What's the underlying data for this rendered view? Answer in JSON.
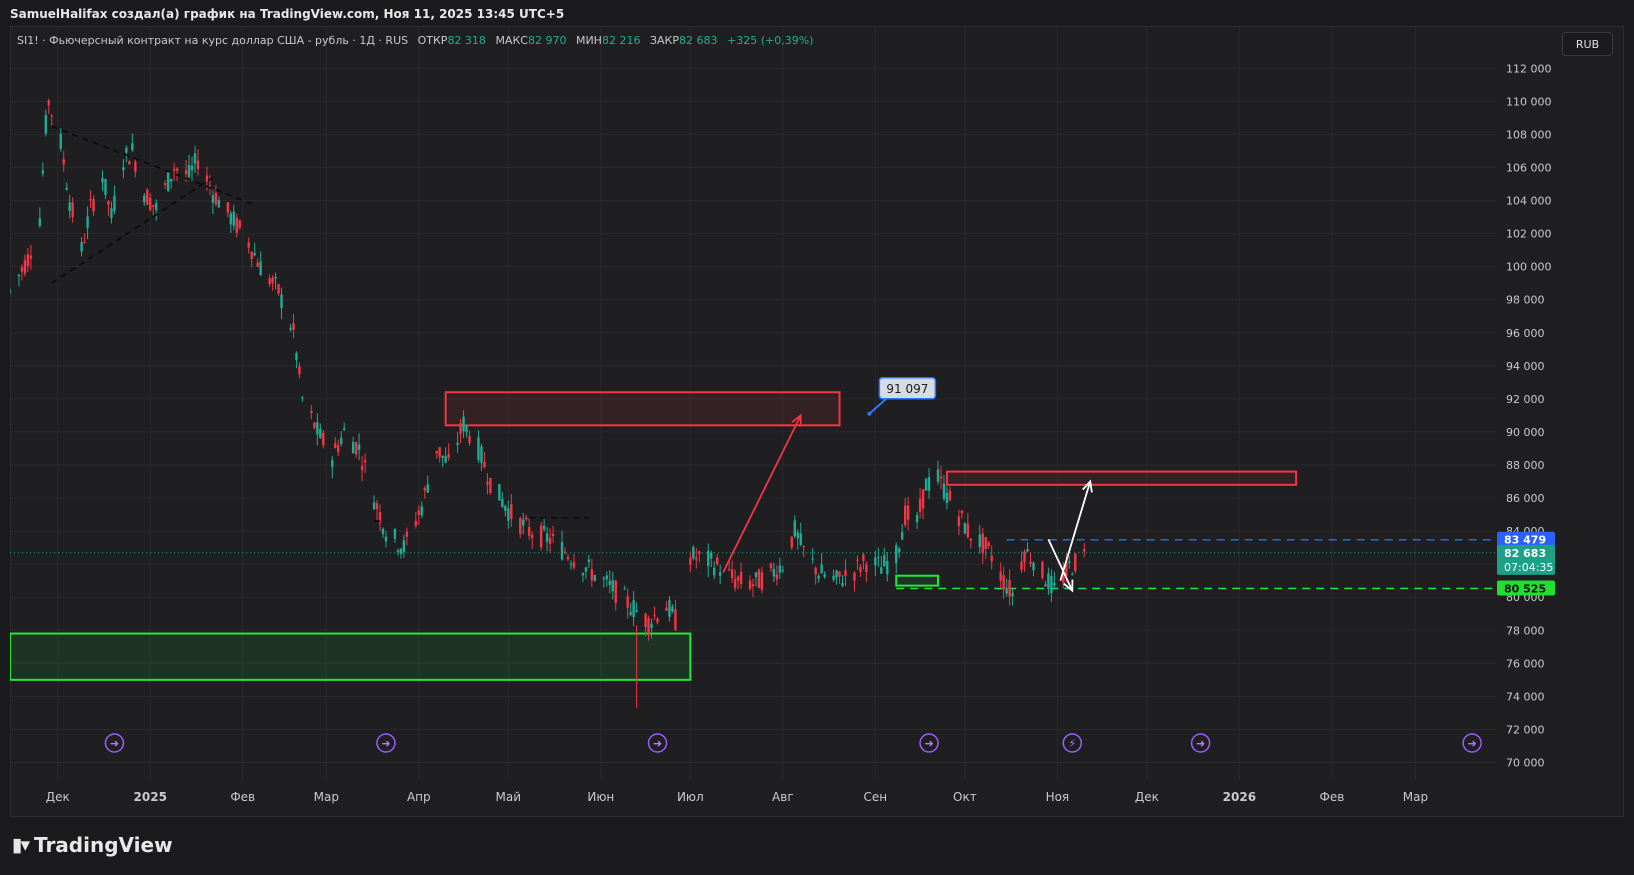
{
  "header": {
    "caption": "SamuelHalifax создал(а) график на TradingView.com, Ноя 11, 2025 13:45 UTC+5"
  },
  "legend": {
    "title": "SI1! · Фьючерсный контракт на курс доллар США - рубль · 1Д · RUS",
    "open_label": "ОТКР",
    "open": "82 318",
    "high_label": "МАКС",
    "high": "82 970",
    "low_label": "МИН",
    "low": "82 216",
    "close_label": "ЗАКР",
    "close": "82 683",
    "change": "+325 (+0,39%)"
  },
  "currency_button": "RUB",
  "brand": "TradingView",
  "colors": {
    "up": "#22ab94",
    "down": "#f23645",
    "background": "#1f1f21",
    "grid": "#2a2a2d",
    "zone_red": "#f23645",
    "zone_green": "#22e83a",
    "line_blue": "#2962ff",
    "line_green": "#22e83a",
    "arrow_white": "#ffffff"
  },
  "chart_data": {
    "type": "candlestick",
    "symbol": "SI1!",
    "interval": "1Д",
    "x_tick_labels": [
      "Дек",
      "2025",
      "Фев",
      "Мар",
      "Апр",
      "Май",
      "Июн",
      "Июл",
      "Авг",
      "Сен",
      "Окт",
      "Ноя",
      "Дек",
      "2026",
      "Фев",
      "Мар"
    ],
    "x_range": [
      "2024-11-15",
      "2026-03-28"
    ],
    "y_ticks": [
      70000,
      72000,
      74000,
      76000,
      78000,
      80000,
      82000,
      84000,
      86000,
      88000,
      90000,
      92000,
      94000,
      96000,
      98000,
      100000,
      102000,
      104000,
      106000,
      108000,
      110000,
      112000
    ],
    "y_tick_labels": [
      "70 000",
      "72 000",
      "74 000",
      "76 000",
      "78 000",
      "80 000",
      "82 000",
      "84 000",
      "86 000",
      "88 000",
      "90 000",
      "92 000",
      "94 000",
      "96 000",
      "98 000",
      "100 000",
      "102 000",
      "104 000",
      "106 000",
      "108 000",
      "110 000",
      "112 000"
    ],
    "ylim": [
      69000,
      114500
    ],
    "price_path": [
      [
        "2024-11-15",
        98500
      ],
      [
        "2024-11-21",
        100500
      ],
      [
        "2024-11-25",
        103000
      ],
      [
        "2024-11-27",
        108500
      ],
      [
        "2024-11-28",
        110000
      ],
      [
        "2024-12-02",
        107500
      ],
      [
        "2024-12-05",
        104000
      ],
      [
        "2024-12-09",
        101000
      ],
      [
        "2024-12-12",
        103500
      ],
      [
        "2024-12-16",
        105500
      ],
      [
        "2024-12-19",
        103000
      ],
      [
        "2024-12-23",
        106500
      ],
      [
        "2024-12-26",
        107000
      ],
      [
        "2024-12-30",
        104500
      ],
      [
        "2025-01-03",
        103500
      ],
      [
        "2025-01-09",
        106000
      ],
      [
        "2025-01-14",
        105500
      ],
      [
        "2025-01-17",
        106500
      ],
      [
        "2025-01-22",
        104500
      ],
      [
        "2025-01-28",
        103000
      ],
      [
        "2025-02-03",
        101500
      ],
      [
        "2025-02-07",
        100000
      ],
      [
        "2025-02-13",
        98500
      ],
      [
        "2025-02-18",
        96000
      ],
      [
        "2025-02-21",
        92000
      ],
      [
        "2025-02-26",
        90000
      ],
      [
        "2025-03-03",
        88500
      ],
      [
        "2025-03-07",
        90000
      ],
      [
        "2025-03-12",
        89000
      ],
      [
        "2025-03-17",
        86000
      ],
      [
        "2025-03-21",
        84000
      ],
      [
        "2025-03-27",
        83000
      ],
      [
        "2025-04-02",
        85500
      ],
      [
        "2025-04-07",
        89000
      ],
      [
        "2025-04-11",
        88000
      ],
      [
        "2025-04-16",
        90500
      ],
      [
        "2025-04-21",
        89000
      ],
      [
        "2025-04-25",
        87000
      ],
      [
        "2025-05-02",
        85000
      ],
      [
        "2025-05-08",
        84000
      ],
      [
        "2025-05-15",
        83500
      ],
      [
        "2025-05-22",
        82500
      ],
      [
        "2025-05-29",
        81500
      ],
      [
        "2025-06-05",
        80500
      ],
      [
        "2025-06-11",
        79500
      ],
      [
        "2025-06-17",
        78500
      ],
      [
        "2025-06-23",
        79500
      ],
      [
        "2025-06-27",
        78300
      ]
    ],
    "price_path_2": [
      [
        "2025-07-01",
        82500
      ],
      [
        "2025-07-07",
        82200
      ],
      [
        "2025-07-11",
        81800
      ],
      [
        "2025-07-16",
        81000
      ],
      [
        "2025-07-22",
        80800
      ],
      [
        "2025-07-28",
        81400
      ],
      [
        "2025-08-01",
        82000
      ],
      [
        "2025-08-05",
        84000
      ],
      [
        "2025-08-08",
        82800
      ],
      [
        "2025-08-13",
        81500
      ],
      [
        "2025-08-19",
        81000
      ],
      [
        "2025-08-25",
        81600
      ],
      [
        "2025-08-29",
        82200
      ],
      [
        "2025-09-03",
        81800
      ],
      [
        "2025-09-08",
        82500
      ],
      [
        "2025-09-11",
        85000
      ],
      [
        "2025-09-15",
        84500
      ],
      [
        "2025-09-18",
        86800
      ],
      [
        "2025-09-22",
        87200
      ],
      [
        "2025-09-25",
        86200
      ],
      [
        "2025-09-29",
        85000
      ],
      [
        "2025-10-02",
        84000
      ],
      [
        "2025-10-07",
        83200
      ],
      [
        "2025-10-10",
        82500
      ],
      [
        "2025-10-14",
        81000
      ],
      [
        "2025-10-17",
        80200
      ],
      [
        "2025-10-21",
        82800
      ],
      [
        "2025-10-24",
        82300
      ],
      [
        "2025-10-28",
        81200
      ],
      [
        "2025-10-31",
        80400
      ],
      [
        "2025-11-05",
        81800
      ],
      [
        "2025-11-11",
        82683
      ]
    ],
    "red_wick_spike": {
      "date": "2025-06-13",
      "high": 78300,
      "low": 73300
    },
    "zones": [
      {
        "color": "red",
        "from": "2025-04-10",
        "to": "2025-08-20",
        "low": 90400,
        "high": 92400
      },
      {
        "color": "red",
        "from": "2025-09-25",
        "to": "2026-01-20",
        "low": 86800,
        "high": 87600
      },
      {
        "color": "green",
        "from": "2024-11-15",
        "to": "2025-07-01",
        "low": 75000,
        "high": 77800
      },
      {
        "color": "green",
        "from": "2025-09-08",
        "to": "2025-09-22",
        "low": 80700,
        "high": 81300
      }
    ],
    "horizontal_lines": [
      {
        "price": 83479,
        "label": "83 479",
        "color": "blue",
        "style": "dashed",
        "from": "2025-10-15"
      },
      {
        "price": 80525,
        "label": "80 525",
        "color": "green",
        "style": "dashed",
        "from": "2025-09-08"
      }
    ],
    "current_price": {
      "price": 82683,
      "label": "82 683",
      "countdown": "07:04:35"
    },
    "price_note": {
      "label": "91 097",
      "date": "2025-08-30",
      "price": 91097
    },
    "arrows": [
      {
        "color": "red",
        "from": [
          "2025-07-12",
          81500
        ],
        "to": [
          "2025-08-07",
          91000
        ]
      },
      {
        "color": "white",
        "from": [
          "2025-11-02",
          81000
        ],
        "to": [
          "2025-11-12",
          87000
        ]
      },
      {
        "color": "white",
        "from": [
          "2025-10-29",
          83500
        ],
        "to": [
          "2025-11-06",
          80400
        ]
      }
    ],
    "trendlines": [
      {
        "from": [
          "2024-11-29",
          108500
        ],
        "to": [
          "2025-02-04",
          103800
        ]
      },
      {
        "from": [
          "2024-11-29",
          99000
        ],
        "to": [
          "2025-01-22",
          105400
        ]
      },
      {
        "from": [
          "2025-05-08",
          84800
        ],
        "to": [
          "2025-05-28",
          84800
        ]
      },
      {
        "from": [
          "2025-03-17",
          84600
        ],
        "to": [
          "2025-03-21",
          84600
        ]
      }
    ],
    "event_markers": [
      {
        "date": "2024-12-20",
        "icon": "dividend-arrow-icon"
      },
      {
        "date": "2025-03-21",
        "icon": "dividend-arrow-icon"
      },
      {
        "date": "2025-06-20",
        "icon": "dividend-arrow-icon"
      },
      {
        "date": "2025-09-19",
        "icon": "dividend-arrow-icon"
      },
      {
        "date": "2025-11-06",
        "icon": "lightning-icon"
      },
      {
        "date": "2025-12-19",
        "icon": "dividend-arrow-icon"
      },
      {
        "date": "2026-03-20",
        "icon": "dividend-arrow-icon"
      }
    ]
  }
}
